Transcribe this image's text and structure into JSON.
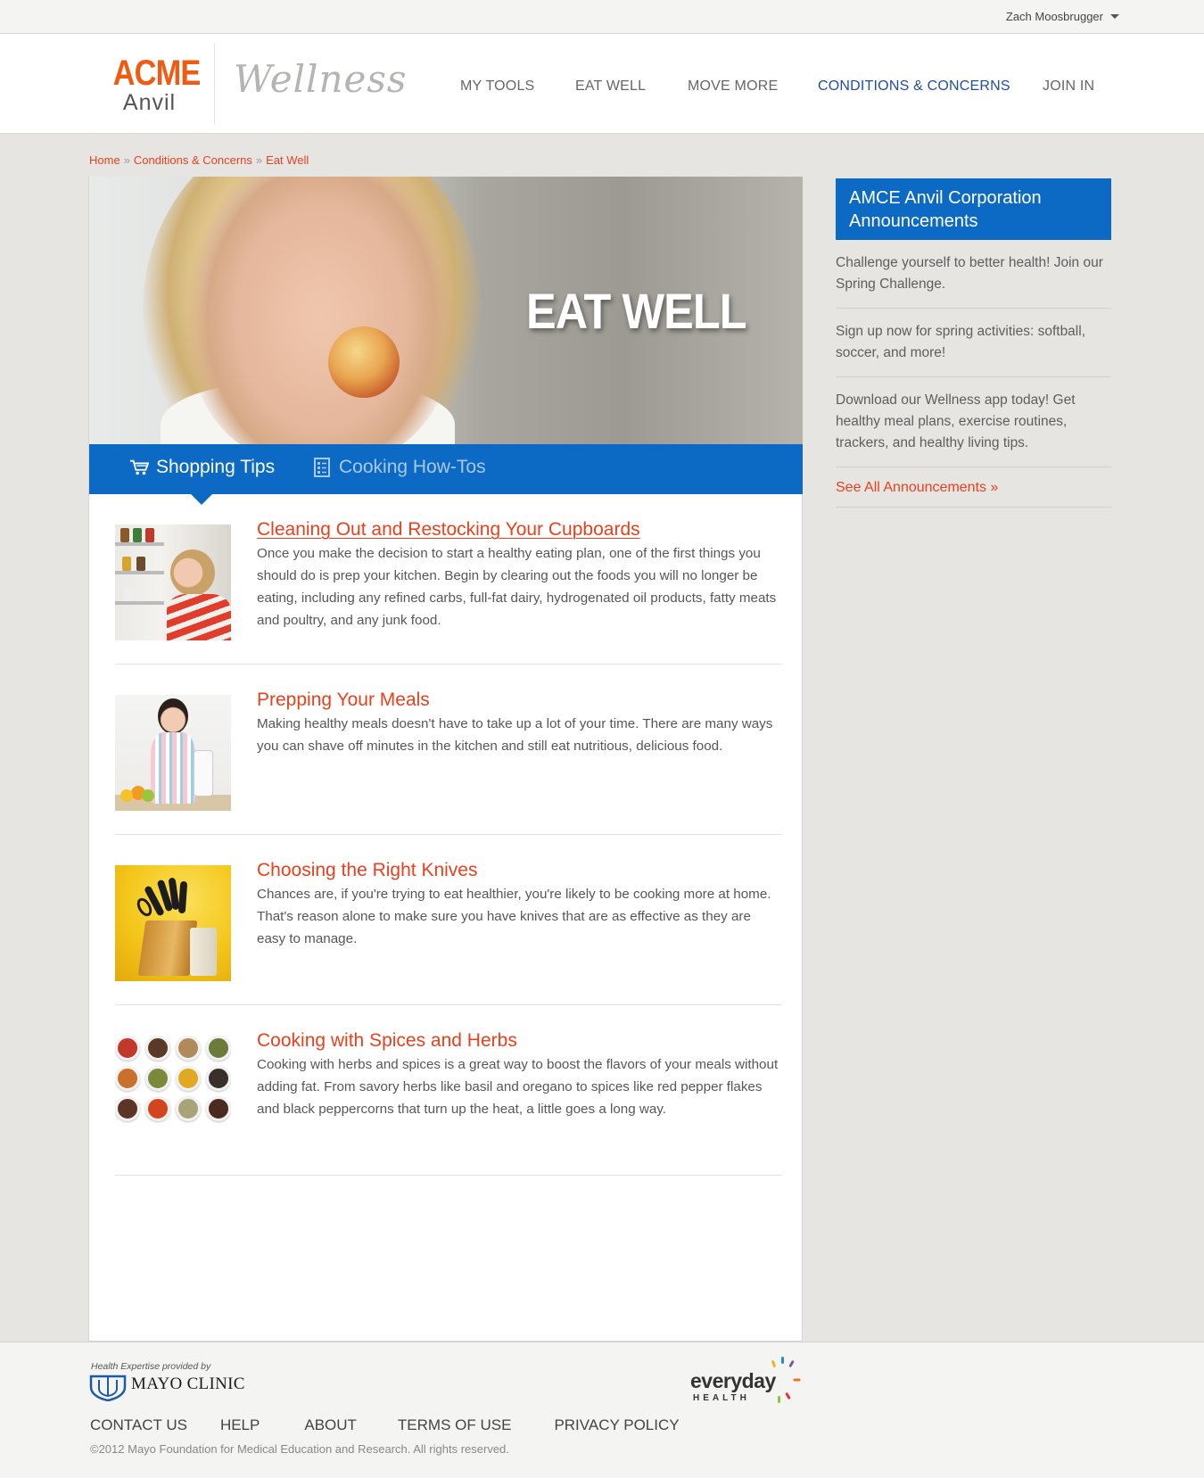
{
  "user": {
    "name": "Zach Moosbrugger"
  },
  "logo": {
    "brand": "ACME",
    "sub": "Anvil",
    "product": "Wellness"
  },
  "nav": {
    "items": [
      {
        "label": "MY TOOLS",
        "active": false
      },
      {
        "label": "EAT WELL",
        "active": false
      },
      {
        "label": "MOVE MORE",
        "active": false
      },
      {
        "label": "CONDITIONS & CONCERNS",
        "active": true
      },
      {
        "label": "JOIN IN",
        "active": false
      }
    ]
  },
  "breadcrumb": {
    "items": [
      "Home",
      "Conditions & Concerns",
      "Eat Well"
    ],
    "separator": "»"
  },
  "hero": {
    "title": "EAT WELL"
  },
  "tabs": [
    {
      "label": "Shopping Tips",
      "icon": "cart-icon",
      "active": true
    },
    {
      "label": "Cooking How-Tos",
      "icon": "checklist-icon",
      "active": false
    }
  ],
  "articles": [
    {
      "title": "Cleaning Out and Restocking Your Cupboards",
      "description": "Once you make the decision to start a healthy eating plan, one of the first things you should do is prep your kitchen. Begin by clearing out the foods you will no longer be eating, including any refined carbs, full-fat dairy, hydrogenated oil products, fatty meats and poultry, and any junk food."
    },
    {
      "title": "Prepping Your Meals",
      "description": "Making healthy meals doesn't have to take up a lot of your time. There are many ways you can shave off minutes in the kitchen and still eat nutritious, delicious food."
    },
    {
      "title": "Choosing the Right Knives",
      "description": "Chances are, if you're trying to eat healthier, you're likely to be cooking more at home. That's reason alone to make sure you have knives that are as effective as they are easy to manage."
    },
    {
      "title": "Cooking with Spices and Herbs",
      "description": "Cooking with herbs and spices is a great way to boost the flavors of your meals without adding fat. From savory herbs like basil and oregano to spices like red pepper flakes and black peppercorns that turn up the heat, a little goes a long way."
    }
  ],
  "sidebar": {
    "heading": "AMCE Anvil Corporation Announcements",
    "items": [
      "Challenge yourself to better health! Join our Spring Challenge.",
      "Sign up now for spring activities: softball, soccer, and more!",
      "Download our Wellness app today! Get healthy meal plans, exercise routines, trackers, and healthy living tips."
    ],
    "link": "See All Announcements »"
  },
  "footer": {
    "provided_by": "Health Expertise provided by",
    "mayo": "MAYO CLINIC",
    "partner_word": "everyday",
    "partner_sub": "HEALTH",
    "links": [
      "CONTACT US",
      "HELP",
      "ABOUT",
      "TERMS OF USE",
      "PRIVACY POLICY"
    ],
    "copyright": "©2012 Mayo Foundation for Medical Education and Research. All rights reserved."
  },
  "colors": {
    "accent_blue": "#0c6ac4",
    "accent_orange": "#e8411e",
    "nav_active": "#1f4fa3"
  }
}
